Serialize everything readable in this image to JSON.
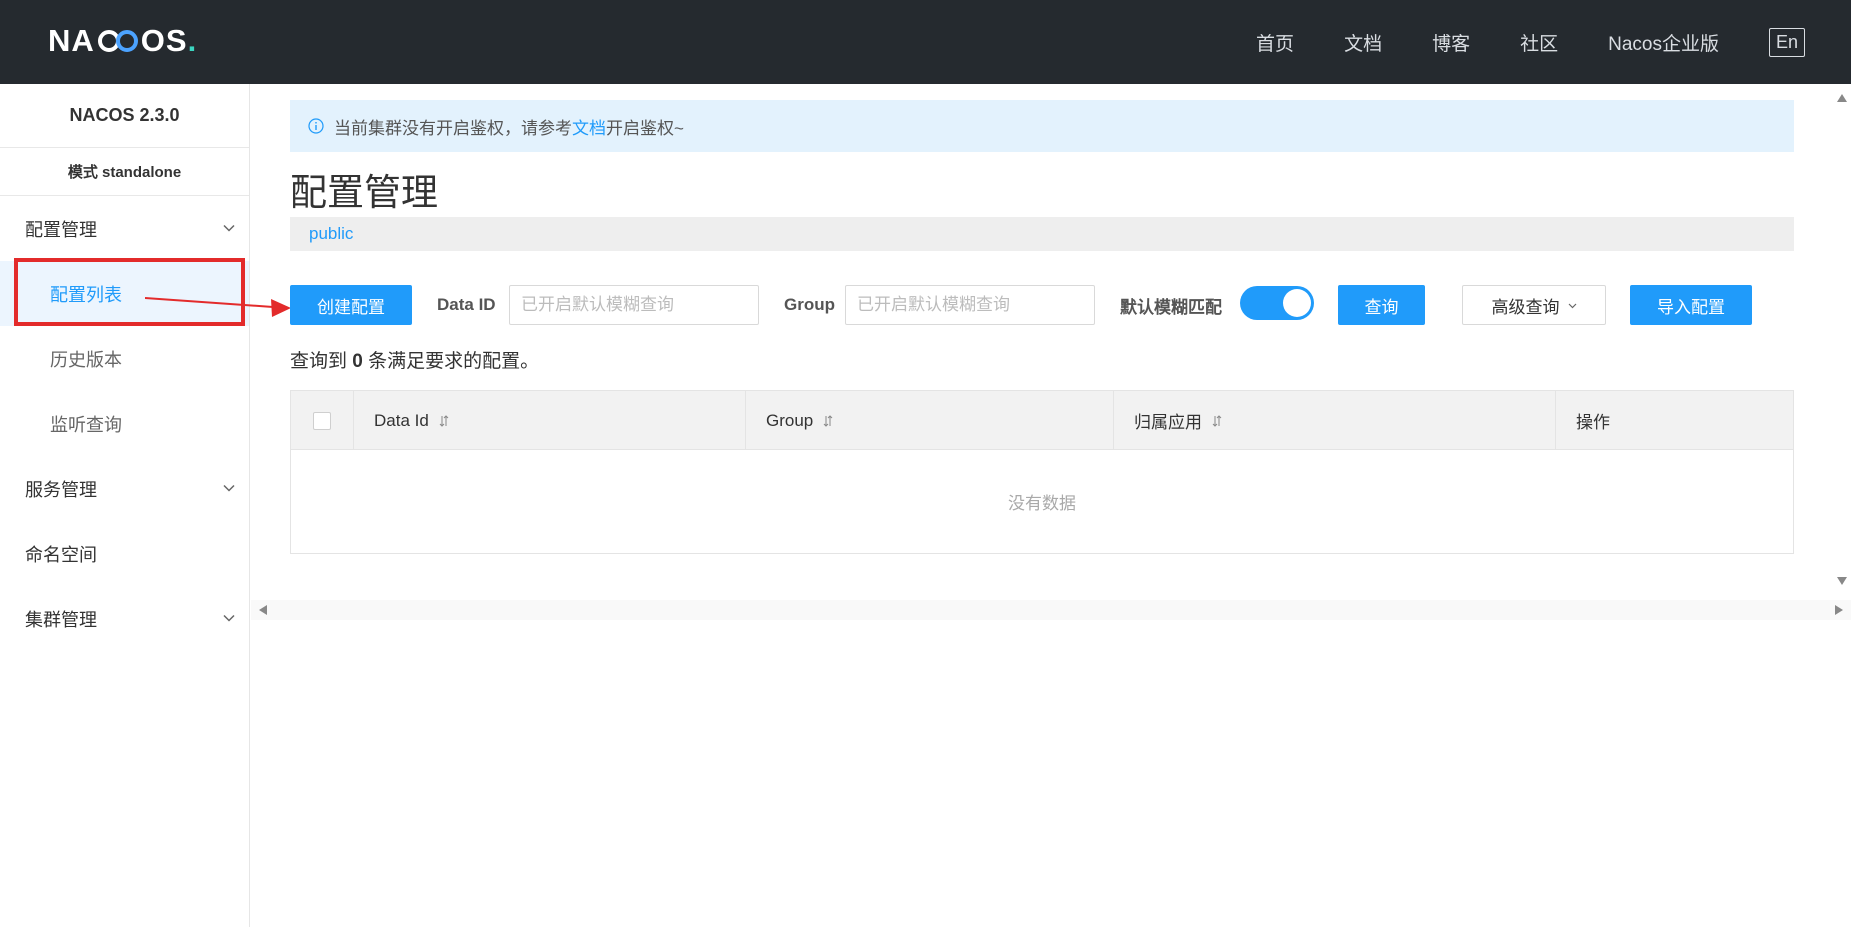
{
  "header": {
    "logo_left": "NA",
    "logo_right": "OS",
    "logo_dot": ".",
    "nav": [
      "首页",
      "文档",
      "博客",
      "社区",
      "Nacos企业版"
    ],
    "lang_button": "En"
  },
  "sidebar": {
    "version": "NACOS 2.3.0",
    "mode": "模式 standalone",
    "groups": {
      "config": "配置管理",
      "config_list": "配置列表",
      "history": "历史版本",
      "listen": "监听查询",
      "service": "服务管理",
      "namespace": "命名空间",
      "cluster": "集群管理"
    }
  },
  "main": {
    "notice_prefix": "当前集群没有开启鉴权，请参考",
    "notice_link": "文档",
    "notice_suffix": "开启鉴权~",
    "title": "配置管理",
    "namespace": "public",
    "toolbar": {
      "create_button": "创建配置",
      "dataid_label": "Data ID",
      "dataid_placeholder": "已开启默认模糊查询",
      "group_label": "Group",
      "group_placeholder": "已开启默认模糊查询",
      "fuzzy_label": "默认模糊匹配",
      "fuzzy_enabled": true,
      "query_button": "查询",
      "advanced_button": "高级查询",
      "import_button": "导入配置"
    },
    "result": {
      "prefix": "查询到",
      "count": "0",
      "suffix": "条满足要求的配置。"
    },
    "table": {
      "columns": [
        "Data Id",
        "Group",
        "归属应用",
        "操作"
      ],
      "empty_text": "没有数据"
    }
  },
  "colors": {
    "primary": "#209bfa",
    "header_bg": "#252a2f",
    "notice_bg": "#e3f2fd",
    "highlight_red": "#e32b2b"
  }
}
